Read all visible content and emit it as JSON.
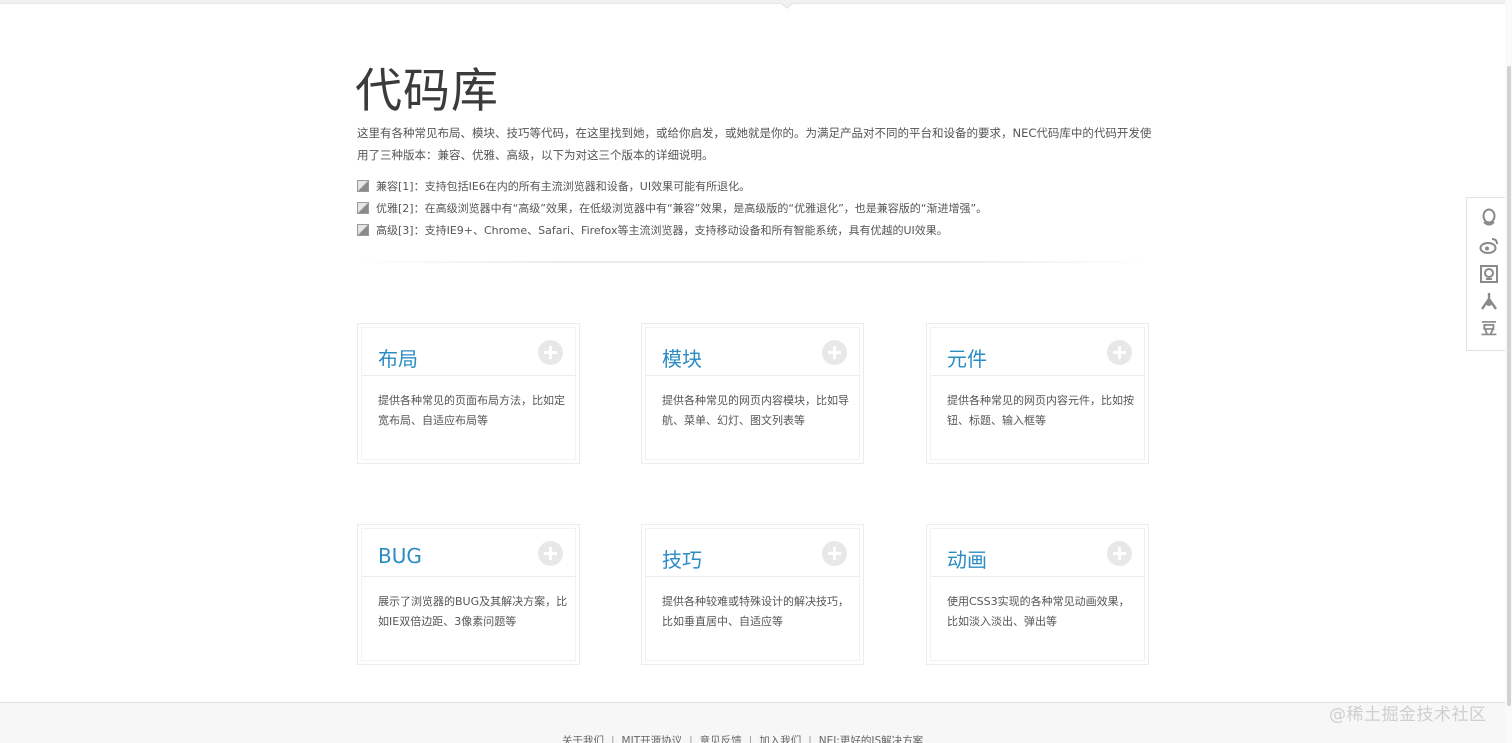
{
  "page": {
    "title": "代码库",
    "intro": "这里有各种常见布局、模块、技巧等代码，在这里找到她，或给你启发，或她就是你的。为满足产品对不同的平台和设备的要求，NEC代码库中的代码开发使用了三种版本：兼容、优雅、高级，以下为对这三个版本的详细说明。",
    "versions": [
      {
        "text": "兼容[1]：支持包括IE6在内的所有主流浏览器和设备，UI效果可能有所退化。"
      },
      {
        "text": "优雅[2]：在高级浏览器中有“高级”效果，在低级浏览器中有“兼容”效果，是高级版的“优雅退化”，也是兼容版的“渐进增强”。"
      },
      {
        "text": "高级[3]：支持IE9+、Chrome、Safari、Firefox等主流浏览器，支持移动设备和所有智能系统，具有优越的UI效果。"
      }
    ]
  },
  "cards": [
    {
      "title": "布局",
      "desc": "提供各种常见的页面布局方法，比如定宽布局、自适应布局等"
    },
    {
      "title": "模块",
      "desc": "提供各种常见的网页内容模块，比如导航、菜单、幻灯、图文列表等"
    },
    {
      "title": "元件",
      "desc": "提供各种常见的网页内容元件，比如按钮、标题、输入框等"
    },
    {
      "title": "BUG",
      "desc": "展示了浏览器的BUG及其解决方案，比如IE双倍边距、3像素问题等"
    },
    {
      "title": "技巧",
      "desc": "提供各种较难或特殊设计的解决技巧，比如垂直居中、自适应等"
    },
    {
      "title": "动画",
      "desc": "使用CSS3实现的各种常见动画效果，比如淡入淡出、弹出等"
    }
  ],
  "share": {
    "icons": [
      "qq-icon",
      "weibo-icon",
      "qzone-icon",
      "renren-icon",
      "douban-icon"
    ],
    "douban_glyph": "豆"
  },
  "footer": {
    "links": [
      "关于我们",
      "MIT开源协议",
      "意见反馈",
      "加入我们",
      "NEJ:更好的JS解决方案"
    ],
    "separator": "|"
  },
  "watermark": "@稀土掘金技术社区",
  "colors": {
    "accent": "#2b8cc4",
    "text": "#555555",
    "heading": "#3b3b3b"
  }
}
